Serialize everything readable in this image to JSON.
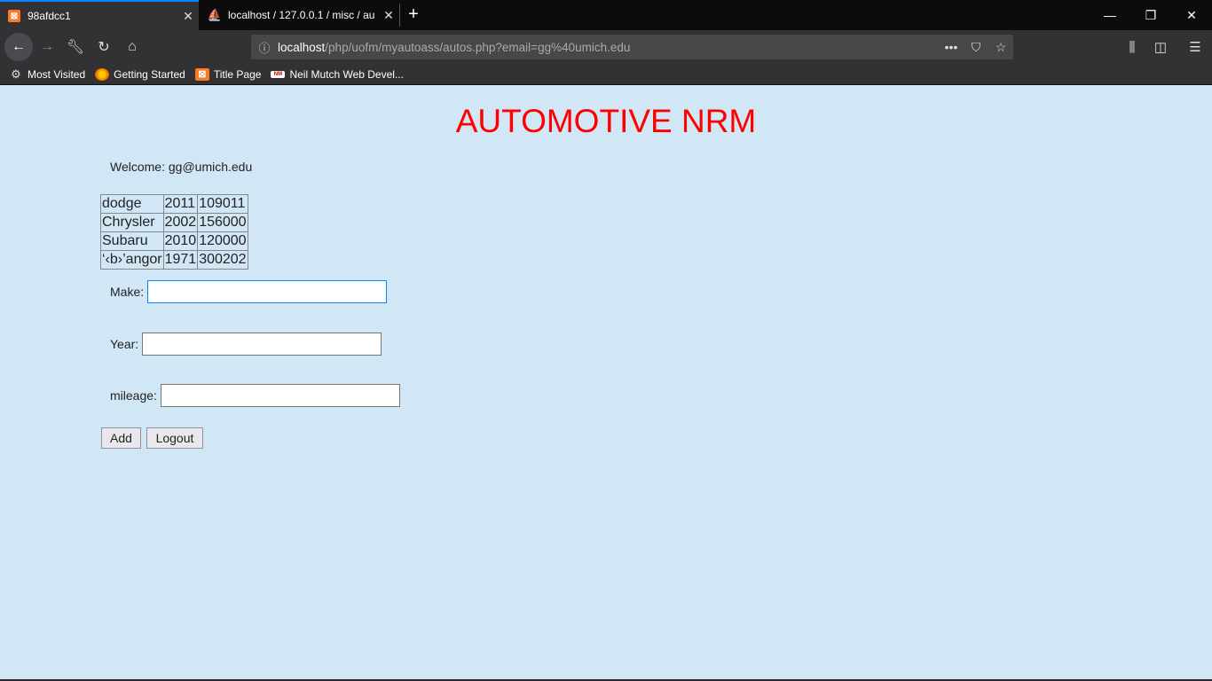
{
  "browser": {
    "tabs": [
      {
        "title": "98afdcc1",
        "active": true
      },
      {
        "title": "localhost / 127.0.0.1 / misc / au",
        "active": false
      }
    ],
    "url_host": "localhost",
    "url_path": "/php/uofm/myautoass/autos.php?email=gg%40umich.edu",
    "bookmarks": [
      {
        "label": "Most Visited",
        "icon": "gear-icon"
      },
      {
        "label": "Getting Started",
        "icon": "firefox-icon"
      },
      {
        "label": "Title Page",
        "icon": "xampp-icon"
      },
      {
        "label": "Neil Mutch Web Devel...",
        "icon": "nm-icon"
      }
    ]
  },
  "page": {
    "title": "AUTOMOTIVE NRM",
    "welcome": "Welcome: gg@umich.edu",
    "autos": [
      [
        "dodge",
        "2011",
        "109011"
      ],
      [
        "Chrysler",
        "2002",
        "156000"
      ],
      [
        "Subaru",
        "2010",
        "120000"
      ],
      [
        "‘‹b›’angor",
        "1971",
        "300202"
      ]
    ],
    "form": {
      "make_label": "Make:",
      "year_label": "Year:",
      "mileage_label": "mileage:",
      "make_value": "",
      "year_value": "",
      "mileage_value": "",
      "add_label": "Add",
      "logout_label": "Logout"
    }
  },
  "colors": {
    "page_bg": "#d2e7f6",
    "title_color": "#ff0000",
    "chrome_dark": "#0c0c0d",
    "chrome_bar": "#323234"
  }
}
